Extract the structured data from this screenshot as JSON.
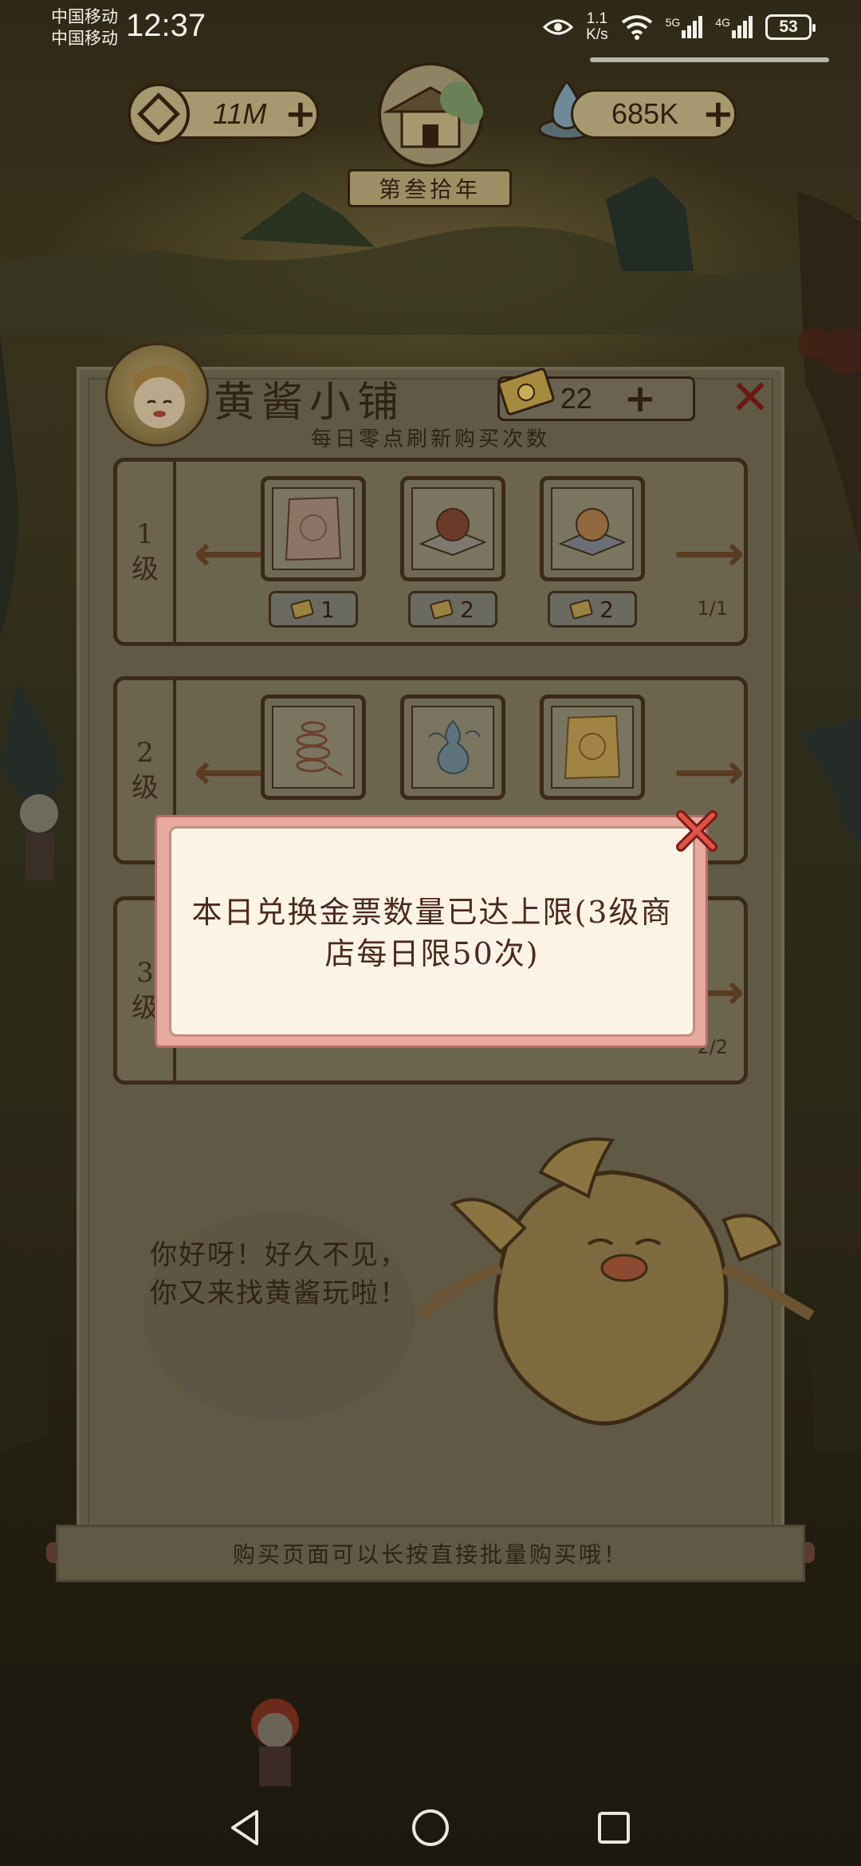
{
  "status_bar": {
    "carrier_1": "中国移动",
    "carrier_2": "中国移动",
    "time": "12:37",
    "net_speed_value": "1.1",
    "net_speed_unit": "K/s",
    "signal_1_label": "5G",
    "signal_2_label": "4G",
    "battery": "53"
  },
  "resources": {
    "coins": "11M",
    "spirit": "685K",
    "year_banner": "第叁拾年"
  },
  "shop": {
    "title": "黄酱小铺",
    "tickets": "22",
    "refresh_note": "每日零点刷新购买次数",
    "tiers": [
      {
        "label_line1": "1",
        "label_line2": "级",
        "items": [
          {
            "icon": "paper-packet-icon",
            "price": "1"
          },
          {
            "icon": "red-pearl-icon",
            "price": "2"
          },
          {
            "icon": "golden-pearl-icon",
            "price": "2"
          }
        ],
        "count": "1/1"
      },
      {
        "label_line1": "2",
        "label_line2": "级",
        "items": [
          {
            "icon": "coiled-rope-icon",
            "price": ""
          },
          {
            "icon": "blue-gourd-icon",
            "price": ""
          },
          {
            "icon": "gold-packet-icon",
            "price": ""
          }
        ],
        "count": ""
      },
      {
        "label_line1": "3",
        "label_line2": "级",
        "items": [],
        "count": "2/2"
      }
    ],
    "mascot_greeting": "你好呀！好久不见，你又来找黄酱玩啦！",
    "bottom_tip": "购买页面可以长按直接批量购买哦！"
  },
  "modal": {
    "message": "本日兑换金票数量已达上限(3级商店每日限50次)"
  },
  "colors": {
    "modal_frame": "#e8a9a0",
    "modal_body": "#fbf3e6",
    "close_red": "#c0392b"
  }
}
